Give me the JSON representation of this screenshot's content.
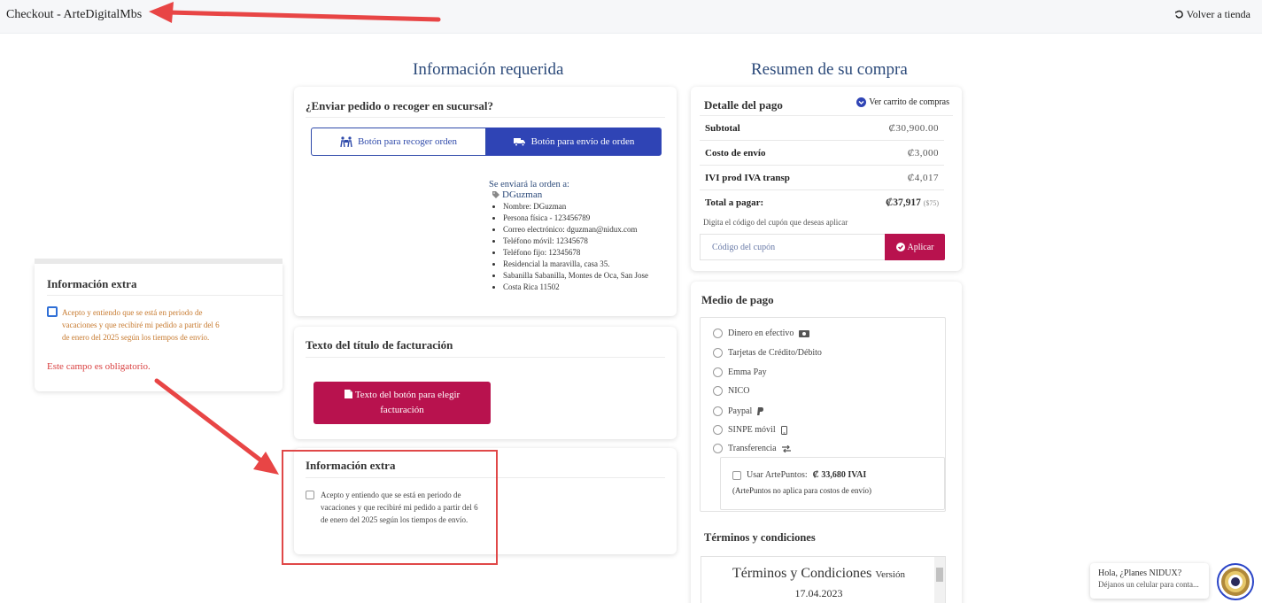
{
  "topbar": {
    "title": "Checkout - ArteDigitalMbs",
    "back_label": "Volver a tienda"
  },
  "headings": {
    "required": "Información requerida",
    "summary": "Resumen de su compra"
  },
  "shipping": {
    "title": "¿Enviar pedido o recoger en sucursal?",
    "pickup_label": "Botón para recoger orden",
    "ship_label": "Botón para envío de orden",
    "address_label": "Se enviará la orden a:",
    "address_name": "DGuzman",
    "address_lines": [
      "Nombre: DGuzman",
      "Persona física - 123456789",
      "Correo electrónico: dguzman@nidux.com",
      "Teléfono móvil: 12345678",
      "Teléfono fijo: 12345678",
      "Residencial la maravilla, casa 35.",
      "Sabanilla Sabanilla, Montes de Oca, San Jose",
      "Costa Rica 11502"
    ]
  },
  "billing": {
    "title": "Texto del título de facturación",
    "button_label": "Texto del botón para elegir facturación"
  },
  "extra_info": {
    "title": "Información extra",
    "checkbox_text": "Acepto y entiendo que se está en periodo de vacaciones y que recibiré mi pedido a partir del 6 de enero del 2025 según los tiempos de envío.",
    "error_text": "Este campo es obligatorio."
  },
  "payment_detail": {
    "title": "Detalle del pago",
    "cart_link": "Ver carrito de compras",
    "rows": [
      {
        "label": "Subtotal",
        "value": "₡30,900.00"
      },
      {
        "label": "Costo de envío",
        "value": "₡3,000"
      },
      {
        "label": "IVI prod IVA transp",
        "value": "₡4,017"
      }
    ],
    "total_label": "Total a pagar:",
    "total_value": "₡37,917",
    "total_usd": "($75)",
    "coupon_prompt": "Digita el código del cupón que deseas aplicar",
    "coupon_placeholder": "Código del cupón",
    "coupon_button": "Aplicar"
  },
  "payment_method": {
    "title": "Medio de pago",
    "options": [
      "Dinero en efectivo",
      "Tarjetas de Crédito/Débito",
      "Emma Pay",
      "NICO",
      "Paypal",
      "SINPE móvil",
      "Transferencia"
    ],
    "points_label": "Usar ArtePuntos:",
    "points_value": "₡ 33,680 IVAI",
    "points_note": "(ArtePuntos no aplica para costos de envío)"
  },
  "terms": {
    "title": "Términos y condiciones",
    "doc_title": "Términos y Condiciones",
    "version_label": "Versión",
    "version_date": "17.04.2023"
  },
  "chat": {
    "line1": "Hola, ¿Planes NIDUX?",
    "line2": "Déjanos un celular para conta..."
  },
  "colors": {
    "primary_blue": "#2f44b5",
    "accent_magenta": "#b8124e",
    "annotation_red": "#e04848",
    "heading_blue": "#2c4a7a"
  }
}
